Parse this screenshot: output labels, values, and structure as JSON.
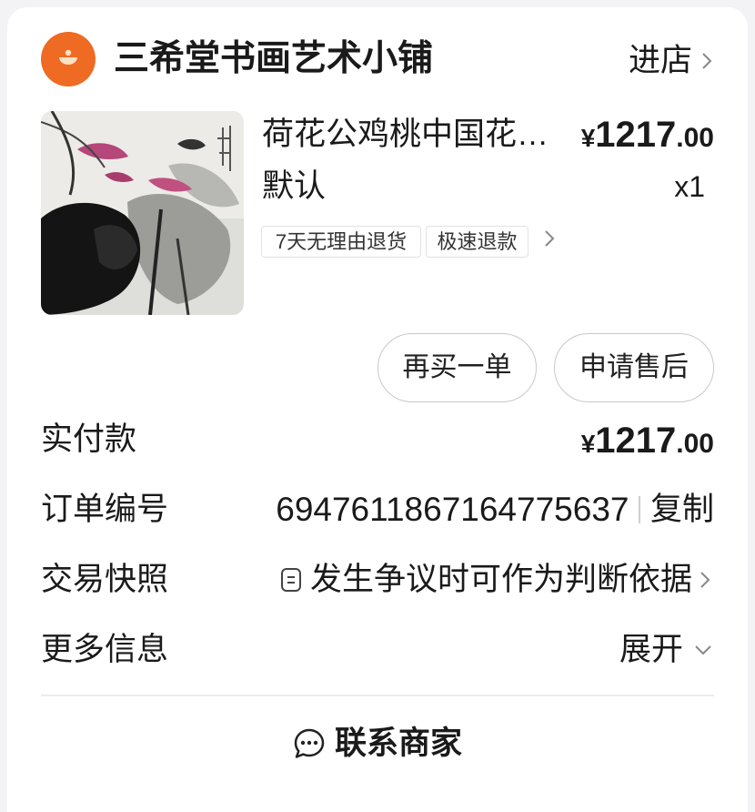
{
  "shop": {
    "name": "三希堂书画艺术小铺",
    "enter_label": "进店"
  },
  "product": {
    "title": "荷花公鸡桃中国花…",
    "price": {
      "symbol": "¥",
      "integer": "1217",
      "decimal": ".00"
    },
    "variant": "默认",
    "quantity": "x1",
    "service_tags": [
      "7天无理由退货",
      "极速退款"
    ]
  },
  "actions": {
    "buy_again": "再买一单",
    "after_sale": "申请售后"
  },
  "order_info": {
    "amount_paid": {
      "label": "实付款",
      "symbol": "¥",
      "integer": "1217",
      "decimal": ".00"
    },
    "order_number": {
      "label": "订单编号",
      "value": "6947611867164775637",
      "copy_label": "复制"
    },
    "trade_snapshot": {
      "label": "交易快照",
      "hint": "发生争议时可作为判断依据"
    },
    "more_info": {
      "label": "更多信息",
      "expand_label": "展开"
    }
  },
  "footer": {
    "contact_label": "联系商家"
  },
  "icons": {
    "shop_logo": "shop-logo-icon",
    "enter_shop": "chevron-right-icon",
    "service_tags_more": "chevron-right-icon",
    "snapshot": "document-icon",
    "snapshot_more": "chevron-right-icon",
    "expand": "chevron-down-icon",
    "contact": "chat-bubble-icon"
  },
  "colors": {
    "page_background": "#F3F3F5",
    "card": "#FFFFFF",
    "text": "#1A1A1A",
    "logo": "#EF6A22",
    "chevron": "#888888",
    "button_border": "#C8C8C8"
  }
}
